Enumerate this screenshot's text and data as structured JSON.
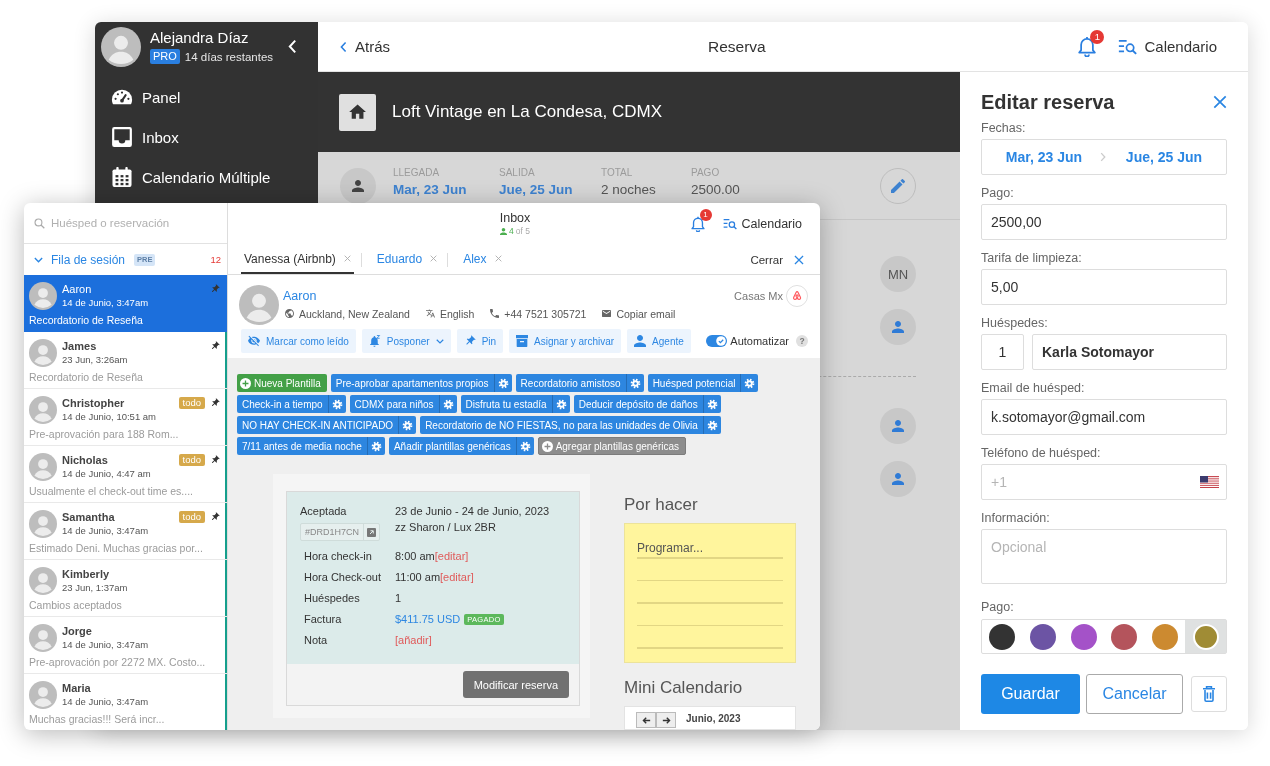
{
  "back_window": {
    "sidebar": {
      "user": {
        "name": "Alejandra Díaz",
        "badge": "PRO",
        "trial": "14 días restantes"
      },
      "items": [
        {
          "label": "Panel"
        },
        {
          "label": "Inbox"
        },
        {
          "label": "Calendario Múltiple"
        }
      ]
    },
    "top_bar": {
      "back": "Atrás",
      "title": "Reserva",
      "notifications": "1",
      "calendar": "Calendario"
    },
    "listing": {
      "title": "Loft Vintage en La Condesa, CDMX"
    },
    "summary": [
      {
        "label": "LLEGADA",
        "value": "Mar, 23 Jun",
        "kind": "date"
      },
      {
        "label": "SALIDA",
        "value": "Jue, 25 Jun",
        "kind": "date"
      },
      {
        "label": "TOTAL",
        "value": "2 noches",
        "kind": "plain"
      },
      {
        "label": "PAGO",
        "value": "2500.00",
        "kind": "plain"
      }
    ],
    "guest_groups": [
      {
        "guests": [
          {
            "kind": "initials",
            "initials": "MN"
          },
          {
            "kind": "icon"
          }
        ]
      },
      {
        "guests": [
          {
            "kind": "icon"
          },
          {
            "kind": "icon"
          }
        ]
      }
    ],
    "edit_panel": {
      "title": "Editar reserva",
      "dates": {
        "label": "Fechas:",
        "start": "Mar, 23 Jun",
        "end": "Jue, 25 Jun"
      },
      "fields": [
        {
          "kind": "text",
          "label": "Pago:",
          "value": "2500,00"
        },
        {
          "kind": "text",
          "label": "Tarifa de limpieza:",
          "value": "5,00"
        },
        {
          "kind": "guests",
          "label": "Huéspedes:",
          "count": "1",
          "value": "Karla Sotomayor"
        },
        {
          "kind": "email",
          "label": "Email de huésped:",
          "value": "k.sotomayor@gmail.com"
        },
        {
          "kind": "phone",
          "label": "Teléfono de huésped:",
          "placeholder": "+1"
        },
        {
          "kind": "textarea",
          "label": "Información:",
          "placeholder": "Opcional"
        }
      ],
      "color_picker": {
        "label": "Pago:",
        "swatches": [
          {
            "color": "#333333",
            "selected": false
          },
          {
            "color": "#6c54a4",
            "selected": false
          },
          {
            "color": "#a452c8",
            "selected": false
          },
          {
            "color": "#b4545c",
            "selected": false
          },
          {
            "color": "#cc8a30",
            "selected": false
          },
          {
            "color": "#a08c35",
            "selected": true
          }
        ]
      },
      "buttons": {
        "save": "Guardar",
        "cancel": "Cancelar"
      }
    }
  },
  "inbox_window": {
    "search": {
      "placeholder": "Huésped o reservación"
    },
    "queue": {
      "title": "Fila de sesión",
      "badge": "PRE",
      "count": "12",
      "expanded": true
    },
    "conversations": [
      {
        "name": "Aaron",
        "time": "14 de Junio, 3:47am",
        "preview": "Recordatorio de Reseña",
        "selected": true,
        "pinned": true
      },
      {
        "name": "James",
        "time": "23 Jun, 3:26am",
        "preview": "Recordatorio de Reseña",
        "selected": false,
        "pinned": true
      },
      {
        "name": "Christopher",
        "time": "14 de Junio, 10:51 am",
        "preview": "Pre-aprovación para 188 Rom...",
        "tag": "todo",
        "selected": false,
        "pinned": true
      },
      {
        "name": "Nicholas",
        "time": "14 de Junio, 4:47 am",
        "preview": "Usualmente el check-out time es....",
        "tag": "todo",
        "selected": false,
        "pinned": true
      },
      {
        "name": "Samantha",
        "time": "14 de Junio, 3:47am",
        "preview": "Estimado Deni. Muchas gracias por...",
        "tag": "todo",
        "selected": false,
        "pinned": true
      },
      {
        "name": "Kimberly",
        "time": "23 Jun, 1:37am",
        "preview": "Cambios aceptados",
        "selected": false,
        "pinned": false
      },
      {
        "name": "Jorge",
        "time": "14 de Junio, 3:47am",
        "preview": "Pre-aprovación por 2272 MX. Costo...",
        "selected": false,
        "pinned": false
      },
      {
        "name": "Maria",
        "time": "14 de Junio, 3:47am",
        "preview": "Muchas gracias!!! Será incr...",
        "selected": false,
        "pinned": false
      }
    ],
    "header": {
      "title": "Inbox",
      "agents_online": "4",
      "agents_total": "of 5",
      "notifications": "1",
      "calendar": "Calendario"
    },
    "tabs": [
      {
        "label": "Vanessa (Airbnb)",
        "selected": true
      },
      {
        "label": "Eduardo",
        "selected": false
      },
      {
        "label": "Alex",
        "selected": false
      }
    ],
    "close_tabs": "Cerrar",
    "guest": {
      "name": "Aaron",
      "location": "Auckland, New Zealand",
      "language": "English",
      "phone": "+44 7521 305721",
      "email": "Copiar email",
      "account": "Casas Mx"
    },
    "actions": [
      {
        "label": "Marcar como leído"
      },
      {
        "label": "Posponer",
        "dropdown": true
      },
      {
        "label": "Pin"
      },
      {
        "label": "Asignar y archivar"
      },
      {
        "label": "Agente"
      }
    ],
    "automate": {
      "label": "Automatizar",
      "on": true,
      "help": "?"
    },
    "templates": [
      {
        "kind": "new",
        "label": "Nueva Plantilla"
      },
      {
        "kind": "template",
        "label": "Pre-aprobar apartamentos propios"
      },
      {
        "kind": "template",
        "label": "Recordatorio amistoso"
      },
      {
        "kind": "template",
        "label": "Huésped potencial"
      },
      {
        "kind": "template",
        "label": "Check-in a tiempo"
      },
      {
        "kind": "template",
        "label": "CDMX para niños"
      },
      {
        "kind": "template",
        "label": "Disfruta tu estadía"
      },
      {
        "kind": "template",
        "label": "Deducir depósito de daños"
      },
      {
        "kind": "template",
        "label": "NO HAY CHECK-IN ANTICIPADO"
      },
      {
        "kind": "template",
        "label": "Recordatorio de NO FIESTAS, no para las unidades de Olivia"
      },
      {
        "kind": "template",
        "label": "7/11 antes de media noche"
      },
      {
        "kind": "template",
        "label": "Añadir plantillas genéricas"
      },
      {
        "kind": "add",
        "label": "Agregar plantillas genéricas"
      }
    ],
    "reservation": {
      "status": "Aceptada",
      "dates": "23 de Junio - 24 de Junio, 2023",
      "code": "#DRD1H7CN",
      "unit": "zz Sharon / Lux 2BR",
      "details": [
        {
          "label": "Hora check-in",
          "value": "8:00 am",
          "link": "[editar]"
        },
        {
          "label": "Hora Check-out",
          "value": "11:00 am",
          "link": "[editar]"
        },
        {
          "label": "Huéspedes",
          "value": "1"
        },
        {
          "label": "Factura",
          "amount": "$411.75 USD",
          "badge": "PAGADO"
        },
        {
          "label": "Nota",
          "link": "[añadir]"
        }
      ],
      "button": "Modificar reserva"
    },
    "todo": {
      "title": "Por hacer",
      "note": "Programar..."
    },
    "mini_calendar": {
      "title": "Mini Calendario",
      "month": "Junio, 2023"
    }
  }
}
